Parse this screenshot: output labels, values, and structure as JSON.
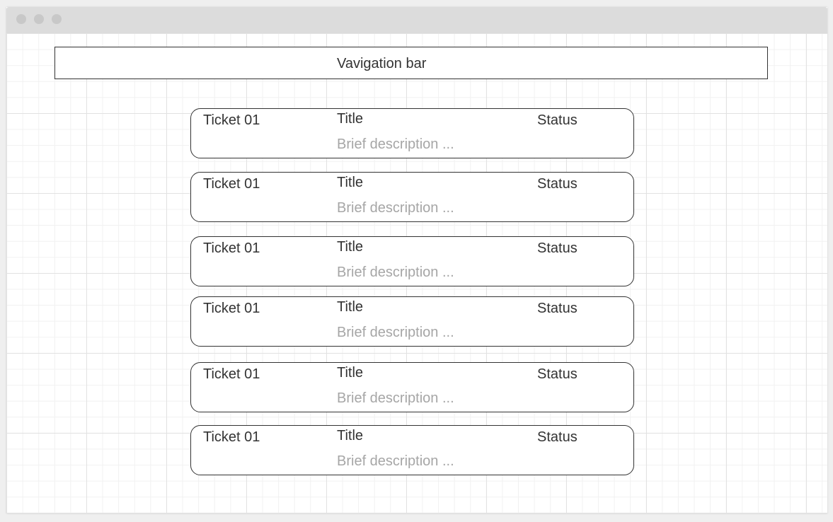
{
  "navbar": {
    "label": "Vavigation bar"
  },
  "tickets": [
    {
      "id": "Ticket 01",
      "title": "Title",
      "status": "Status",
      "description": "Brief description ..."
    },
    {
      "id": "Ticket 01",
      "title": "Title",
      "status": "Status",
      "description": "Brief description ..."
    },
    {
      "id": "Ticket 01",
      "title": "Title",
      "status": "Status",
      "description": "Brief description ..."
    },
    {
      "id": "Ticket 01",
      "title": "Title",
      "status": "Status",
      "description": "Brief description ..."
    },
    {
      "id": "Ticket 01",
      "title": "Title",
      "status": "Status",
      "description": "Brief description ..."
    },
    {
      "id": "Ticket 01",
      "title": "Title",
      "status": "Status",
      "description": "Brief description ..."
    }
  ]
}
